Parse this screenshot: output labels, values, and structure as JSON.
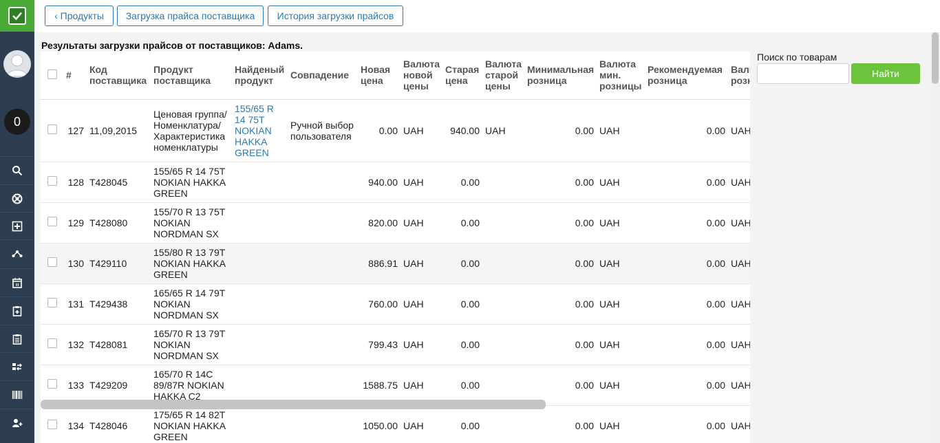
{
  "header": {
    "back_button": "‹ Продукты",
    "upload_button": "Загрузка прайса поставщика",
    "history_button": "История загрузки прайсов"
  },
  "sidebar": {
    "counter": "0",
    "icons": [
      "search-icon",
      "support-icon",
      "add-icon",
      "share-icon",
      "calendar-icon",
      "clipboard-add-icon",
      "clipboard-list-icon",
      "transfer-icon",
      "barcode-icon",
      "user-add-icon"
    ]
  },
  "page": {
    "title": "Результаты загрузки прайсов от поставщиков: Adams."
  },
  "search": {
    "label": "Поиск по товарам",
    "placeholder": "",
    "button": "Найти"
  },
  "table": {
    "columns": [
      "#",
      "Код поставщика",
      "Продукт поставщика",
      "Найденый продукт",
      "Совпадение",
      "Новая цена",
      "Валюта новой цены",
      "Старая цена",
      "Валюта старой цены",
      "Минимальная розница",
      "Валюта мин. розницы",
      "Рекомендуемая розница",
      "Валюта рек. розн"
    ],
    "rows": [
      {
        "n": "127",
        "code": "11,09,2015",
        "product": "Ценовая группа/ Номенклатура/ Характеристика номенклатуры",
        "found": "155/65 R 14 75T NOKIAN HAKKA GREEN",
        "match": "Ручной выбор пользователя",
        "new_price": "0.00",
        "new_cur": "UAH",
        "old_price": "940.00",
        "old_cur": "UAH",
        "min_retail": "0.00",
        "min_cur": "UAH",
        "rec_retail": "0.00",
        "rec_cur": "UAH"
      },
      {
        "n": "128",
        "code": "T428045",
        "product": "155/65 R 14 75T NOKIAN HAKKA GREEN",
        "found": "",
        "match": "",
        "new_price": "940.00",
        "new_cur": "UAH",
        "old_price": "0.00",
        "old_cur": "",
        "min_retail": "0.00",
        "min_cur": "UAH",
        "rec_retail": "0.00",
        "rec_cur": "UAH"
      },
      {
        "n": "129",
        "code": "T428080",
        "product": "155/70 R 13 75T NOKIAN NORDMAN SX",
        "found": "",
        "match": "",
        "new_price": "820.00",
        "new_cur": "UAH",
        "old_price": "0.00",
        "old_cur": "",
        "min_retail": "0.00",
        "min_cur": "UAH",
        "rec_retail": "0.00",
        "rec_cur": "UAH"
      },
      {
        "n": "130",
        "code": "T429110",
        "product": "155/80 R 13 79T NOKIAN HAKKA GREEN",
        "found": "",
        "match": "",
        "new_price": "886.91",
        "new_cur": "UAH",
        "old_price": "0.00",
        "old_cur": "",
        "min_retail": "0.00",
        "min_cur": "UAH",
        "rec_retail": "0.00",
        "rec_cur": "UAH"
      },
      {
        "n": "131",
        "code": "T429438",
        "product": "165/65 R 14 79T NOKIAN NORDMAN SX",
        "found": "",
        "match": "",
        "new_price": "760.00",
        "new_cur": "UAH",
        "old_price": "0.00",
        "old_cur": "",
        "min_retail": "0.00",
        "min_cur": "UAH",
        "rec_retail": "0.00",
        "rec_cur": "UAH"
      },
      {
        "n": "132",
        "code": "T428081",
        "product": "165/70 R 13 79T NOKIAN NORDMAN SX",
        "found": "",
        "match": "",
        "new_price": "799.43",
        "new_cur": "UAH",
        "old_price": "0.00",
        "old_cur": "",
        "min_retail": "0.00",
        "min_cur": "UAH",
        "rec_retail": "0.00",
        "rec_cur": "UAH"
      },
      {
        "n": "133",
        "code": "T429209",
        "product": "165/70 R 14C 89/87R NOKIAN HAKKA C2",
        "found": "",
        "match": "",
        "new_price": "1588.75",
        "new_cur": "UAH",
        "old_price": "0.00",
        "old_cur": "",
        "min_retail": "0.00",
        "min_cur": "UAH",
        "rec_retail": "0.00",
        "rec_cur": "UAH"
      },
      {
        "n": "134",
        "code": "T428046",
        "product": "175/65 R 14 82T NOKIAN HAKKA GREEN",
        "found": "",
        "match": "",
        "new_price": "1050.00",
        "new_cur": "UAH",
        "old_price": "0.00",
        "old_cur": "",
        "min_retail": "0.00",
        "min_cur": "UAH",
        "rec_retail": "0.00",
        "rec_cur": "UAH"
      }
    ]
  }
}
